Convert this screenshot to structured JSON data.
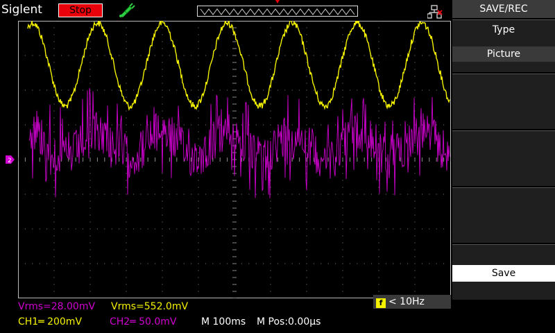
{
  "top": {
    "brand": "Siglent",
    "run_state": "Stop",
    "run_state_color": "#e8000a"
  },
  "menu": {
    "title": "SAVE/REC",
    "type_label": "Type",
    "type_value": "Picture",
    "save_label": "Save"
  },
  "trigger": {
    "frequency": "< 10Hz",
    "f_icon": "f"
  },
  "measurements": {
    "ch2_vrms": "Vrms=28.00mV",
    "ch1_vrms": "Vrms=552.0mV"
  },
  "status": {
    "ch1": "CH1═ 200mV",
    "ch2": "CH2═ 50.0mV",
    "timebase": "M 100ms",
    "mpos": "M Pos:0.00µs"
  },
  "colors": {
    "ch1": "#f5f200",
    "ch2": "#d000d0",
    "grid": "#8a8a8a"
  },
  "waveforms": {
    "ch1": {
      "type": "sine",
      "cycles": 6.5,
      "noise": "low"
    },
    "ch2": {
      "type": "noisy-sine",
      "cycles": 6.5,
      "noise": "high"
    }
  }
}
